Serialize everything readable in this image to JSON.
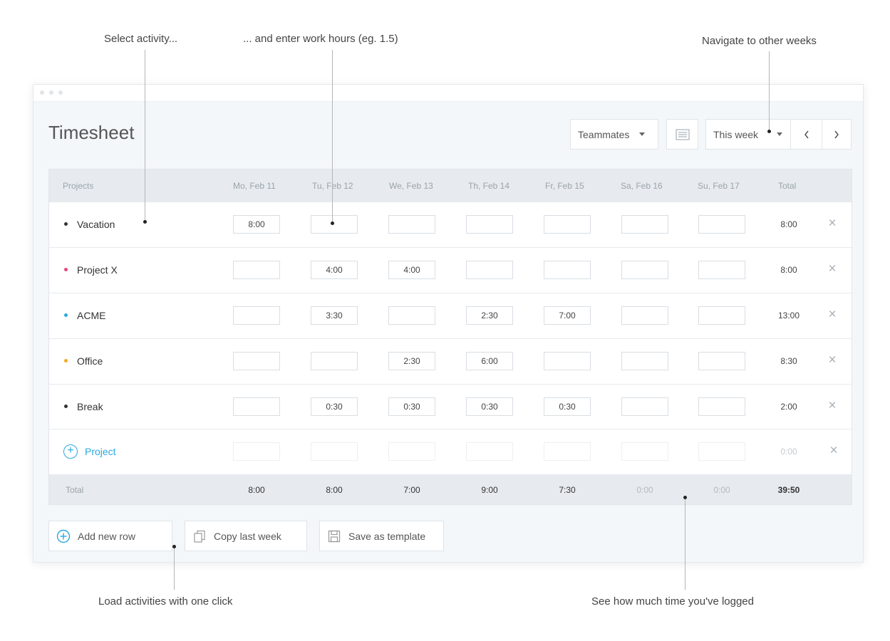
{
  "annotations": {
    "select_activity": "Select activity...",
    "enter_hours": "... and enter work hours (eg. 1.5)",
    "navigate": "Navigate to other weeks",
    "load_activities": "Load activities with one click",
    "see_logged": "See how much time you've logged"
  },
  "header": {
    "title": "Timesheet",
    "teammates_label": "Teammates",
    "week_label": "This week"
  },
  "icons": {
    "list_view": "list-view-icon",
    "prev": "chevron-left-icon",
    "next": "chevron-right-icon",
    "delete": "close-icon",
    "add": "plus-circle-icon",
    "copy": "copy-icon",
    "save": "save-icon"
  },
  "table": {
    "projects_header": "Projects",
    "days": [
      "Mo, Feb 11",
      "Tu, Feb 12",
      "We, Feb 13",
      "Th, Feb 14",
      "Fr, Feb 15",
      "Sa, Feb 16",
      "Su, Feb 17"
    ],
    "total_header": "Total",
    "rows": [
      {
        "name": "Vacation",
        "color": "#333333",
        "values": [
          "8:00",
          "",
          "",
          "",
          "",
          "",
          ""
        ],
        "total": "8:00"
      },
      {
        "name": "Project X",
        "color": "#e8477a",
        "values": [
          "",
          "4:00",
          "4:00",
          "",
          "",
          "",
          ""
        ],
        "total": "8:00"
      },
      {
        "name": "ACME",
        "color": "#2aa9e0",
        "values": [
          "",
          "3:30",
          "",
          "2:30",
          "7:00",
          "",
          ""
        ],
        "total": "13:00"
      },
      {
        "name": "Office",
        "color": "#f5a623",
        "values": [
          "",
          "",
          "2:30",
          "6:00",
          "",
          "",
          ""
        ],
        "total": "8:30"
      },
      {
        "name": "Break",
        "color": "#333333",
        "values": [
          "",
          "0:30",
          "0:30",
          "0:30",
          "0:30",
          "",
          ""
        ],
        "total": "2:00"
      }
    ],
    "new_row_label": "Project",
    "new_row_total": "0:00",
    "footer_label": "Total",
    "day_totals": [
      "8:00",
      "8:00",
      "7:00",
      "9:00",
      "7:30",
      "0:00",
      "0:00"
    ],
    "grand_total": "39:50",
    "accent_color": "#2aa9e0"
  },
  "actions": {
    "add_row": "Add new row",
    "copy_week": "Copy last week",
    "save_template": "Save as template"
  }
}
